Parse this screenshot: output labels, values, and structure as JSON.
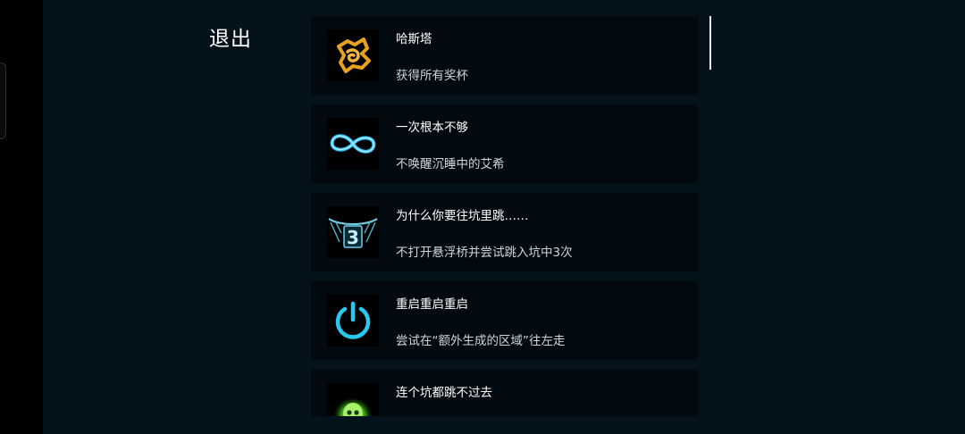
{
  "menu": {
    "exit_label": "退出"
  },
  "achievements": [
    {
      "title": "哈斯塔",
      "description": "获得所有奖杯",
      "icon": "hastur-sigil-icon",
      "color": "#e8a21c"
    },
    {
      "title": "一次根本不够",
      "description": "不唤醒沉睡中的艾希",
      "icon": "infinity-icon",
      "color": "#39c6ff"
    },
    {
      "title": "为什么你要往坑里跳……",
      "description": "不打开悬浮桥并尝试跳入坑中3次",
      "icon": "bridge-three-icon",
      "icon_text": "3",
      "color": "#6fd0ea"
    },
    {
      "title": "重启重启重启",
      "description": "尝试在“额外生成的区域”往左走",
      "icon": "power-icon",
      "color": "#27c9ee"
    },
    {
      "title": "连个坑都跳不过去",
      "description": "",
      "icon": "green-skull-icon",
      "color": "#5fd12a"
    }
  ]
}
